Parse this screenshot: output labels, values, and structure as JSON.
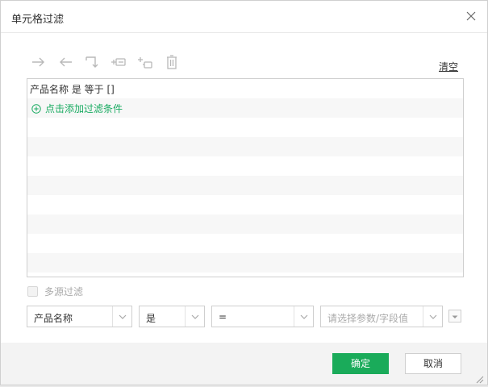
{
  "dialog": {
    "title": "单元格过滤",
    "close_icon": "close-icon"
  },
  "toolbar": {
    "icons": [
      "indent-right-icon",
      "indent-left-icon",
      "swap-icon",
      "add-condition-icon",
      "add-sub-condition-icon",
      "delete-icon"
    ],
    "clear_label": "清空"
  },
  "conditions": {
    "rows": [
      {
        "text": "产品名称 是 等于 []"
      }
    ],
    "add_label": "点击添加过滤条件"
  },
  "multi_source": {
    "label": "多源过滤",
    "checked": false
  },
  "editor": {
    "field": {
      "value": "产品名称"
    },
    "relation": {
      "value": "是"
    },
    "operator": {
      "value": "="
    },
    "param": {
      "placeholder": "请选择参数/字段值"
    }
  },
  "footer": {
    "ok_label": "确定",
    "cancel_label": "取消"
  },
  "colors": {
    "accent": "#1aab5a",
    "link": "#1aab62"
  }
}
